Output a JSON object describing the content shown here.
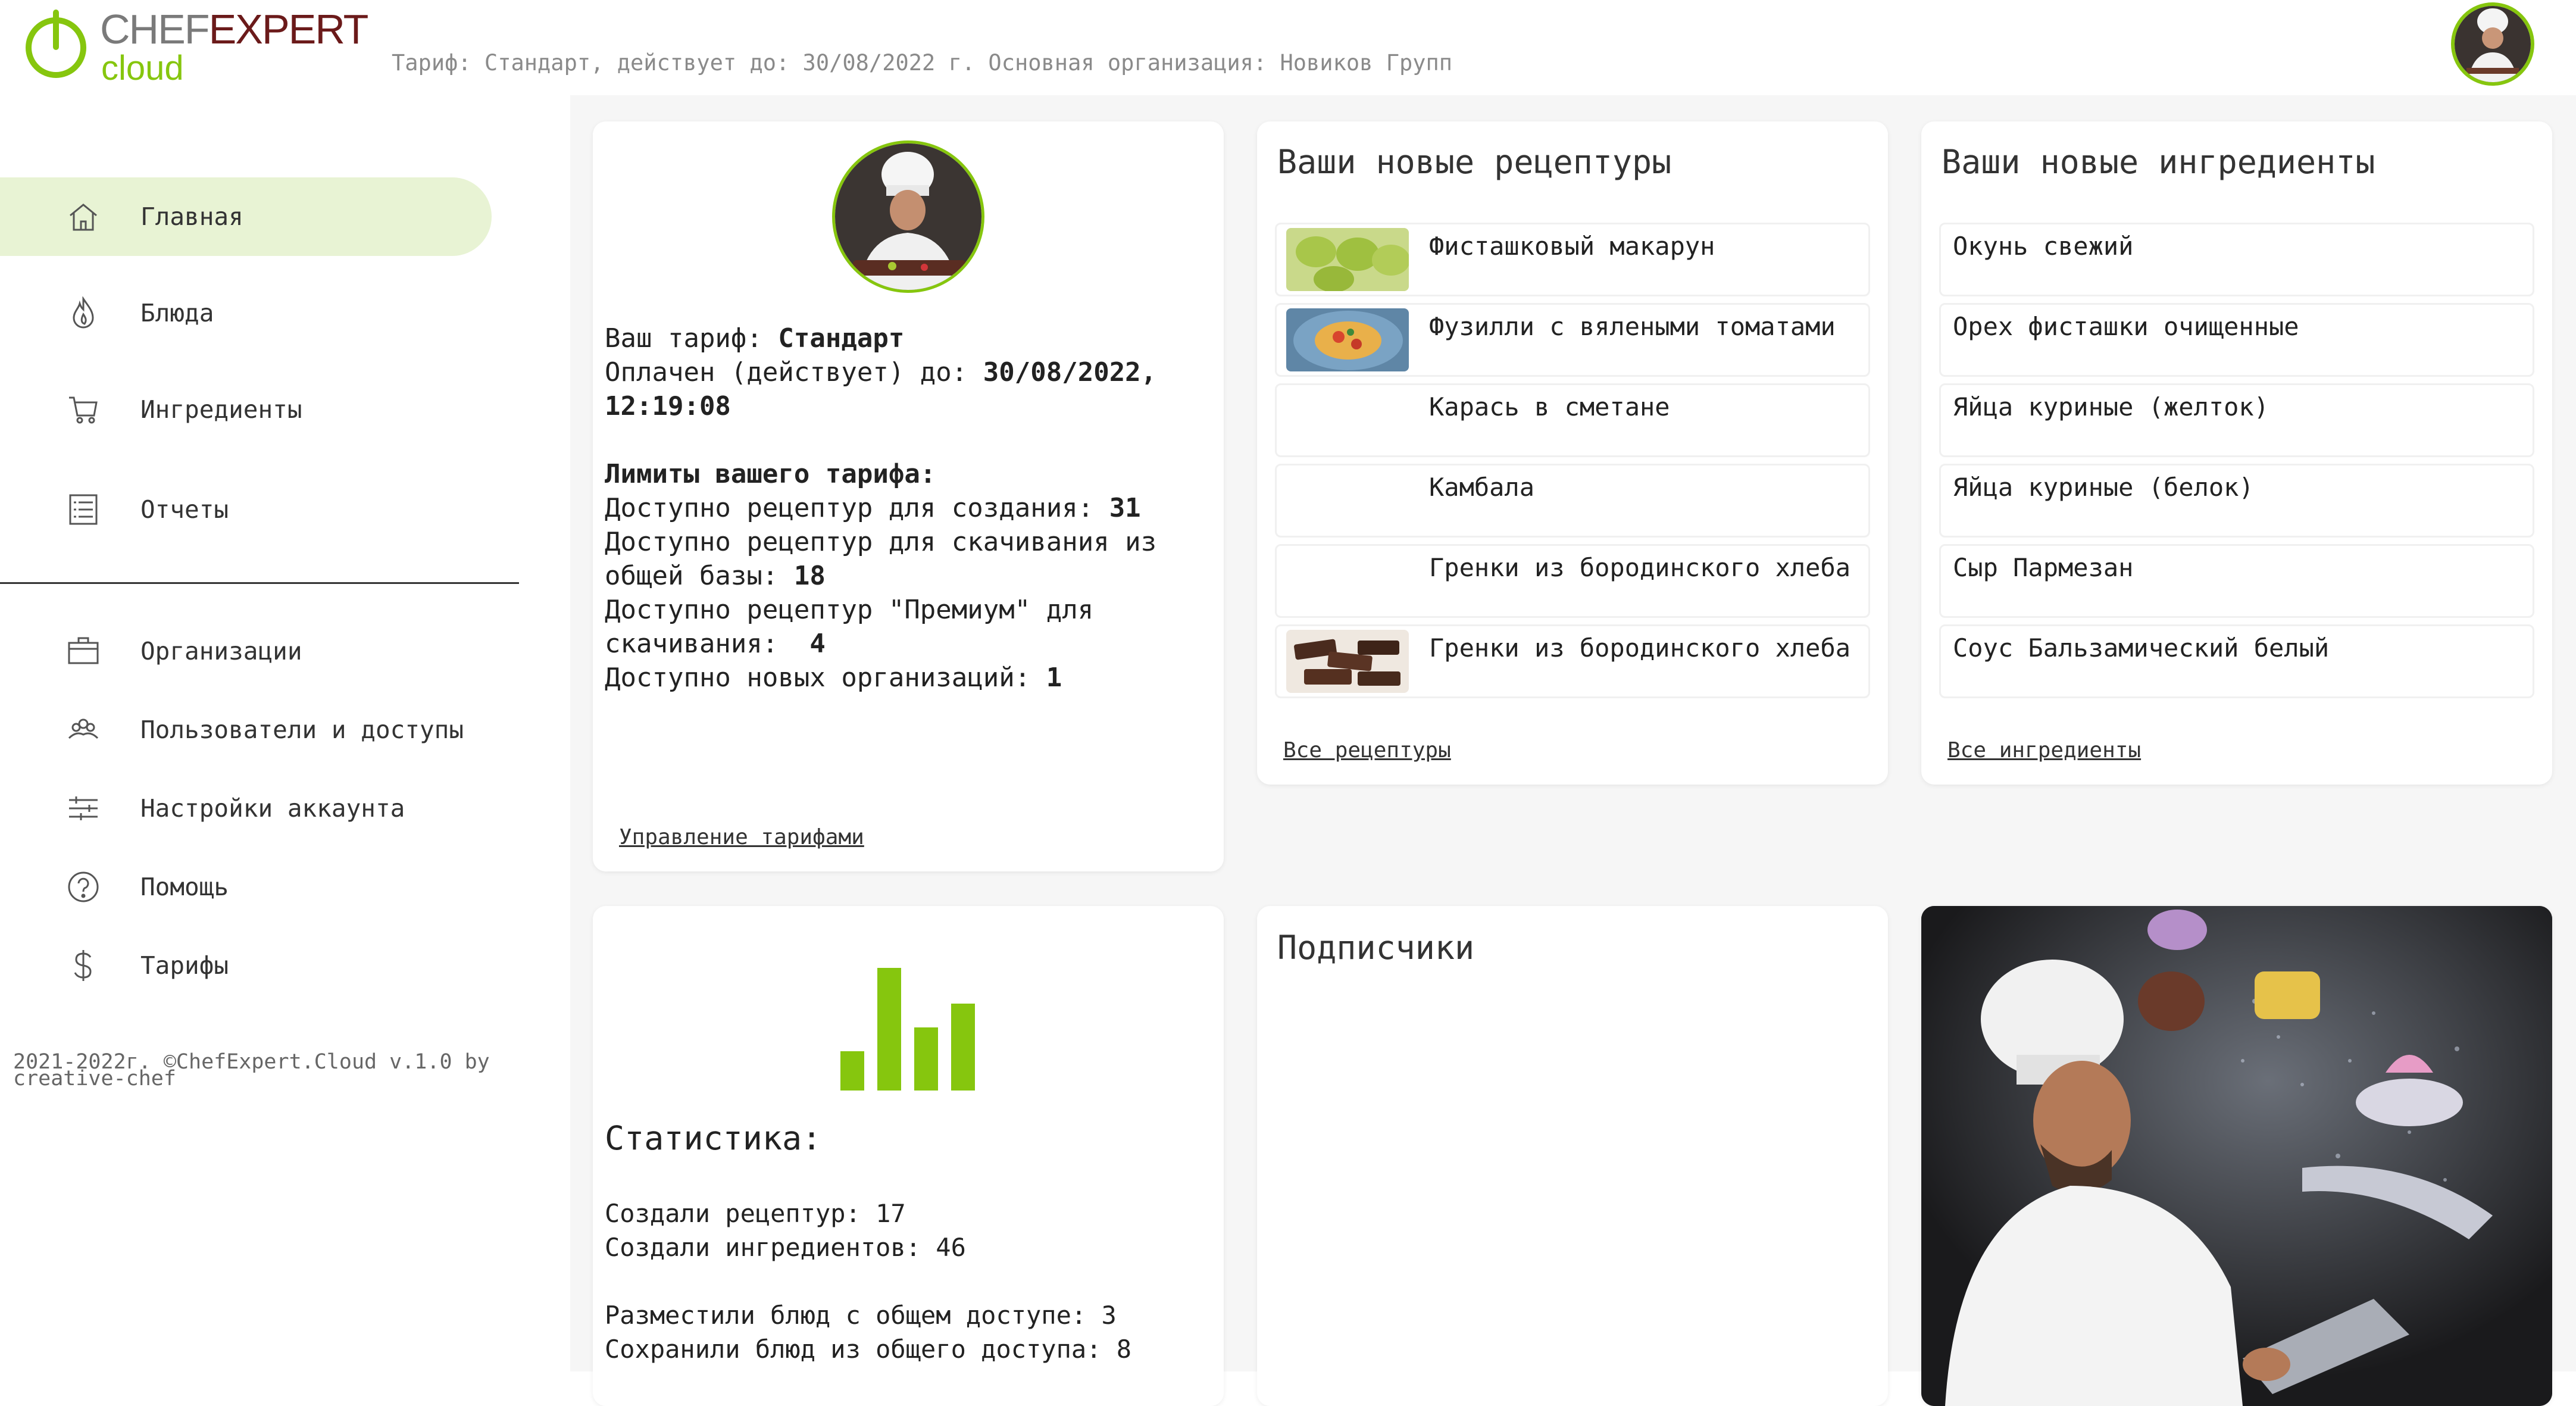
{
  "header": {
    "logo_part1": "CHEF",
    "logo_part2": "EXPERT",
    "logo_sub": "cloud",
    "info": "Тариф: Стандарт, действует до: 30/08/2022 г. Основная организация: Новиков Групп"
  },
  "colors": {
    "accent": "#86c60e",
    "brand_dark": "#6b1a1a",
    "active_bg": "#e8f3d4",
    "content_bg": "#f6f6f6"
  },
  "sidebar": {
    "main_items": [
      {
        "label": "Главная",
        "icon": "home-icon",
        "active": true
      },
      {
        "label": "Блюда",
        "icon": "flame-icon"
      },
      {
        "label": "Ингредиенты",
        "icon": "cart-icon"
      },
      {
        "label": "Отчеты",
        "icon": "list-icon"
      }
    ],
    "secondary_items": [
      {
        "label": "Организации",
        "icon": "briefcase-icon"
      },
      {
        "label": "Пользователи и доступы",
        "icon": "users-icon"
      },
      {
        "label": "Настройки аккаунта",
        "icon": "sliders-icon"
      },
      {
        "label": "Помощь",
        "icon": "help-icon"
      },
      {
        "label": "Тарифы",
        "icon": "dollar-icon"
      }
    ],
    "footer": "2021-2022г. ©ChefExpert.Cloud v.1.0 by creative-chef"
  },
  "tariff": {
    "plan_label": "Ваш тариф: ",
    "plan_value": "Стандарт",
    "paid_label": "Оплачен (действует) до: ",
    "paid_value": "30/08/2022, 12:19:08",
    "limits_title": "Лимиты вашего тарифа:",
    "limit1_label": "Доступно рецептур для создания: ",
    "limit1_value": "31",
    "limit2_label": "Доступно рецептур для скачивания из общей базы: ",
    "limit2_value": "18",
    "limit3_label": "Доступно рецептур \"Премиум\" для скачивания:  ",
    "limit3_value": "4",
    "limit4_label": "Доступно новых организаций: ",
    "limit4_value": "1",
    "manage_link": "Управление тарифами"
  },
  "recipes": {
    "title": "Ваши новые рецептуры",
    "items": [
      {
        "name": "Фисташковый макарун",
        "thumb": "macaron-photo"
      },
      {
        "name": "Фузилли с вялеными томатами",
        "thumb": "fusilli-photo"
      },
      {
        "name": "Карась в сметане",
        "thumb": ""
      },
      {
        "name": "Камбала",
        "thumb": ""
      },
      {
        "name": "Гренки из бородинского хлеба",
        "thumb": ""
      },
      {
        "name": "Гренки из бородинского хлеба",
        "thumb": "croutons-photo"
      }
    ],
    "all_link": "Все рецептуры"
  },
  "ingredients": {
    "title": "Ваши новые ингредиенты",
    "items": [
      "Окунь свежий",
      "Орех фисташки очищенные",
      "Яйца куриные (желток)",
      "Яйца куриные (белок)",
      "Сыр Пармезан",
      "Соус Бальзамический белый"
    ],
    "all_link": "Все ингредиенты"
  },
  "stats": {
    "title": "Статистика:",
    "line1": "Создали рецептур: 17",
    "line2": "Создали ингредиентов: 46",
    "line3": "Разместили блюд с общем доступе: 3",
    "line4": "Сохранили блюд из общего доступа: 8"
  },
  "subscribers": {
    "title": "Подписчики"
  }
}
